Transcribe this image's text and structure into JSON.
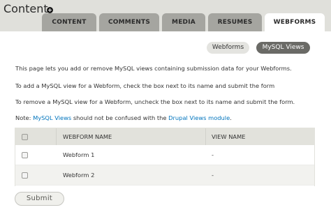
{
  "header": {
    "title": "Content"
  },
  "tabs": [
    {
      "label": "CONTENT"
    },
    {
      "label": "COMMENTS"
    },
    {
      "label": "MEDIA"
    },
    {
      "label": "RESUMES"
    },
    {
      "label": "WEBFORMS"
    }
  ],
  "subtabs": [
    {
      "label": "Webforms"
    },
    {
      "label": "MySQL Views"
    }
  ],
  "content": {
    "intro": "This page lets you add or remove MySQL views containing submission data for your Webforms.",
    "add_instructions": "To add a MySQL view for a Webform, check the box next to its name and submit the form",
    "remove_instructions": "To remove a MySQL view for a Webform, uncheck the box next to its name and submit the form.",
    "note_prefix": "Note: ",
    "note_link1": "MySQL Views",
    "note_middle": " should not be confused with the ",
    "note_link2": "Drupal Views module",
    "note_suffix": "."
  },
  "table": {
    "headers": [
      "WEBFORM NAME",
      "VIEW NAME"
    ],
    "rows": [
      {
        "name": "Webform 1",
        "view": "-"
      },
      {
        "name": "Webform 2",
        "view": "-"
      }
    ]
  },
  "form": {
    "submit_label": "Submit"
  },
  "colors": {
    "header_bg": "#e0e0db",
    "tab_bg": "#a5a5a0",
    "active_pill": "#6a6a66",
    "link": "#0074bd"
  }
}
